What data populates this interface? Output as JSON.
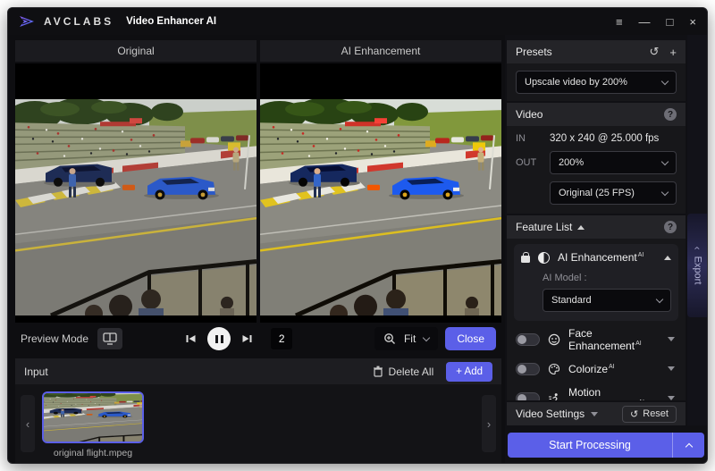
{
  "colors": {
    "accent": "#5b5fe8"
  },
  "titlebar": {
    "brand": "AVCLABS",
    "app_title": "Video Enhancer AI",
    "icons": {
      "menu": "≡",
      "minimize": "—",
      "maximize": "□",
      "close": "×"
    }
  },
  "preview": {
    "original_label": "Original",
    "enhanced_label": "AI Enhancement",
    "preview_mode_label": "Preview Mode",
    "frame_number": "2",
    "zoom_fit_label": "Fit",
    "close_label": "Close"
  },
  "input_section": {
    "title": "Input",
    "delete_all_label": "Delete All",
    "add_label": "+ Add",
    "file_name": "original flight.mpeg",
    "scroll_left": "‹",
    "scroll_right": "›"
  },
  "presets": {
    "title": "Presets",
    "refresh_icon": "↺",
    "add_icon": "+",
    "selected_preset": "Upscale video by 200%"
  },
  "video_info": {
    "title": "Video",
    "help_icon": "?",
    "in_label": "IN",
    "in_value": "320 x 240 @ 25.000 fps",
    "out_label": "OUT",
    "out_scale": "200%",
    "out_fps": "Original (25 FPS)"
  },
  "feature_list": {
    "title": "Feature List",
    "help_icon": "?",
    "items": [
      {
        "name": "AI Enhancement",
        "badge": "AI"
      },
      {
        "name": "Face Enhancement",
        "badge": "AI"
      },
      {
        "name": "Colorize",
        "badge": "AI"
      },
      {
        "name": "Motion Compensation",
        "badge": "AI"
      }
    ],
    "ai_model_label": "AI Model :",
    "ai_model_value": "Standard"
  },
  "footer": {
    "video_settings_label": "Video Settings",
    "reset_icon": "↺",
    "reset_label": "Reset",
    "start_label": "Start Processing"
  },
  "export_tab": {
    "label": "Export",
    "chevron": "‹"
  }
}
